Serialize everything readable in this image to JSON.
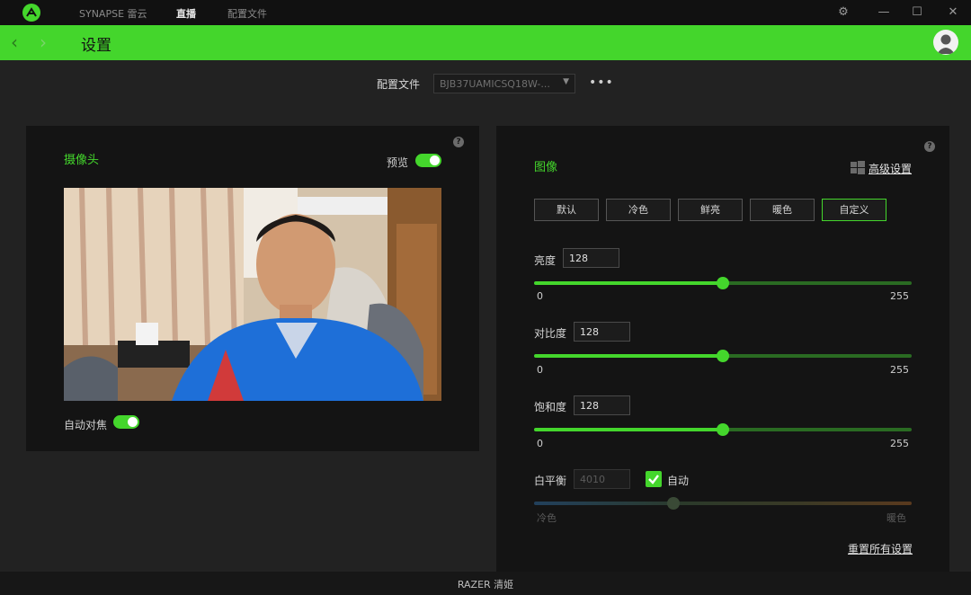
{
  "topnav": {
    "synapse": "SYNAPSE 雷云",
    "live": "直播",
    "profiles": "配置文件"
  },
  "header": {
    "title": "设置"
  },
  "profile": {
    "label": "配置文件",
    "selected": "BJB37UAMICSQ18W-...",
    "more": "•••"
  },
  "camera": {
    "title": "摄像头",
    "preview_label": "预览",
    "preview_on": true,
    "autofocus_label": "自动对焦",
    "autofocus_on": true
  },
  "image": {
    "title": "图像",
    "advanced_label": "高级设置",
    "presets": [
      "默认",
      "冷色",
      "鲜亮",
      "暖色",
      "自定义"
    ],
    "selected_preset": "自定义",
    "sliders": [
      {
        "label": "亮度",
        "value": "128",
        "min": "0",
        "max": "255"
      },
      {
        "label": "对比度",
        "value": "128",
        "min": "0",
        "max": "255"
      },
      {
        "label": "饱和度",
        "value": "128",
        "min": "0",
        "max": "255"
      }
    ],
    "white_balance": {
      "label": "白平衡",
      "value": "4010",
      "auto_label": "自动",
      "auto_checked": true,
      "cool_label": "冷色",
      "warm_label": "暖色"
    },
    "reset_label": "重置所有设置"
  },
  "status": {
    "text": "RAZER 清姬"
  },
  "colors": {
    "accent": "#44d62c",
    "panel": "#141414",
    "background": "#222222"
  }
}
